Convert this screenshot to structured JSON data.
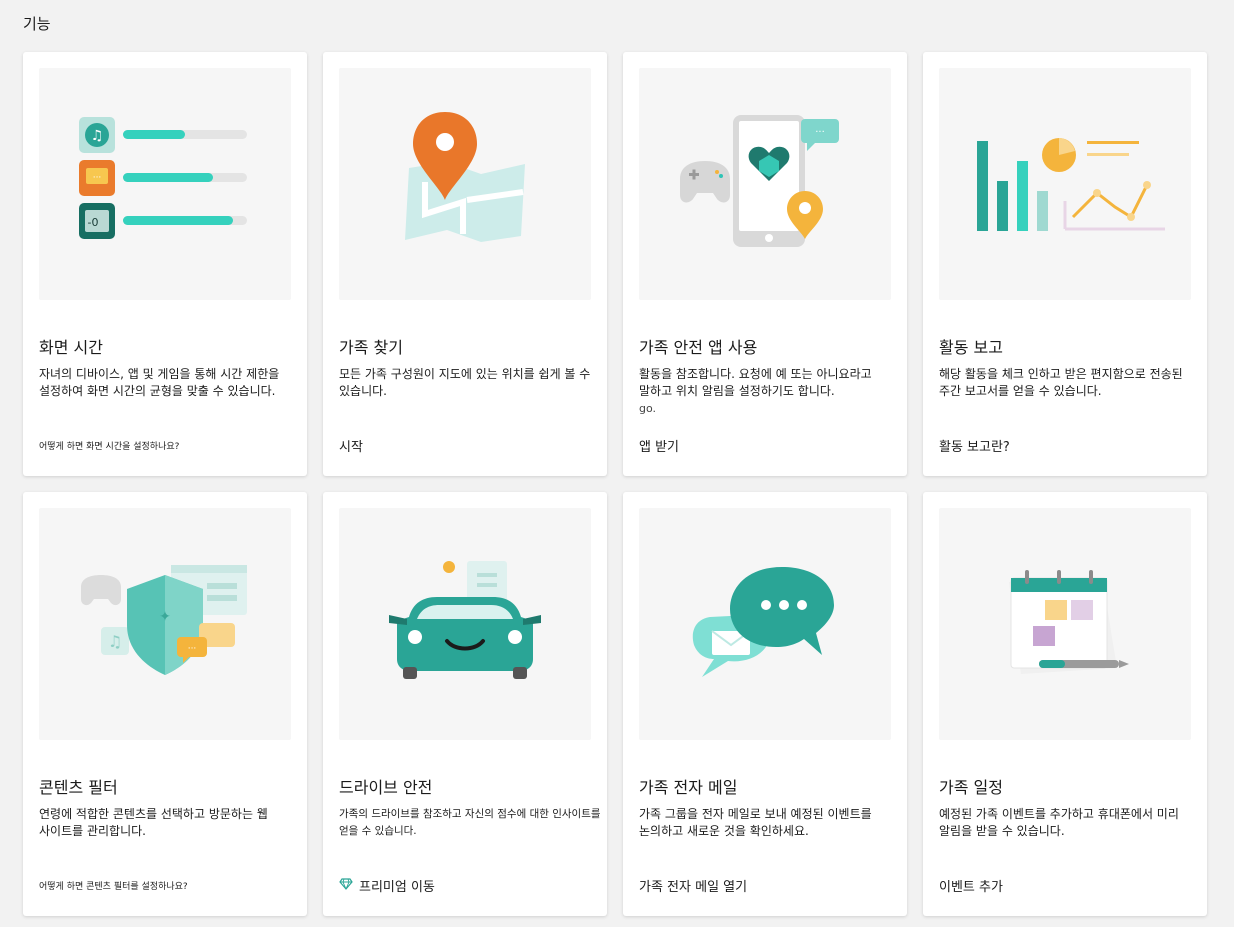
{
  "section": {
    "title": "기능"
  },
  "cards": [
    {
      "title": "화면 시간",
      "description": "자녀의 디바이스, 앱 및 게임을 통해 시간 제한을 설정하여 화면 시간의 균형을 맞출 수 있습니다.",
      "link": "어떻게 하면 화면 시간을 설정하나요?",
      "illustration": "screen-time-illustration"
    },
    {
      "title": "가족 찾기",
      "description": "모든 가족 구성원이 지도에 있는 위치를 쉽게 볼 수 있습니다.",
      "link": "시작",
      "illustration": "map-pin-illustration"
    },
    {
      "title": "가족 안전 앱 사용",
      "description": "활동을 참조합니다. 요청에 예 또는 아니요라고 말하고 위치 알림을 설정하기도 합니다.",
      "extra": "go.",
      "link": "앱 받기",
      "illustration": "phone-app-illustration"
    },
    {
      "title": "활동 보고",
      "description": "해당 활동을 체크 인하고 받은 편지함으로 전송된 주간 보고서를 얻을 수 있습니다.",
      "link": "활동 보고란?",
      "illustration": "report-chart-illustration"
    },
    {
      "title": "콘텐츠 필터",
      "description": "연령에 적합한 콘텐츠를 선택하고 방문하는 웹 사이트를 관리합니다.",
      "link": "어떻게 하면 콘텐츠 필터를 설정하나요?",
      "illustration": "shield-filter-illustration"
    },
    {
      "title": "드라이브 안전",
      "description": "가족의 드라이브를 참조하고 자신의 점수에 대한 인사이트를 얻을 수 있습니다.",
      "link": "프리미엄 이동",
      "link_icon": "diamond-icon",
      "illustration": "car-illustration"
    },
    {
      "title": "가족 전자 메일",
      "description": "가족 그룹을 전자 메일로 보내 예정된 이벤트를 논의하고 새로운 것을 확인하세요.",
      "link": "가족 전자 메일 열기",
      "illustration": "chat-bubble-illustration"
    },
    {
      "title": "가족 일정",
      "description": "예정된 가족 이벤트를 추가하고 휴대폰에서 미리 알림을 받을 수 있습니다.",
      "link": "이벤트 추가",
      "illustration": "calendar-illustration"
    }
  ],
  "colors": {
    "teal": "#2ec4b6",
    "dark_teal": "#1f7a6e",
    "orange": "#e8792b",
    "yellow": "#f4b43c",
    "card_bg": "#ffffff",
    "page_bg": "#f2f2f2"
  }
}
